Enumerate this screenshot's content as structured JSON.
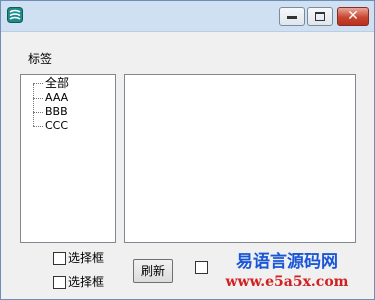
{
  "window": {
    "icon": "app-logo-icon",
    "controls": {
      "minimize": "minimize-icon",
      "maximize": "maximize-icon",
      "close": "✕"
    }
  },
  "tag_label": "标签",
  "tree": {
    "items": [
      "全部",
      "AAA",
      "BBB",
      "CCC"
    ]
  },
  "checkboxes": [
    {
      "label": "选择框",
      "checked": false
    },
    {
      "label": "选择框",
      "checked": false
    },
    {
      "label": "",
      "checked": false
    }
  ],
  "refresh_button": "刷新",
  "watermark": {
    "line1": "易语言源码网",
    "line2": "www.e5a5x.com"
  },
  "colors": {
    "titlebar": "#cfe0f2",
    "close_button": "#c9452e",
    "watermark_blue": "#1a57d6",
    "watermark_red": "#d21f1f"
  }
}
